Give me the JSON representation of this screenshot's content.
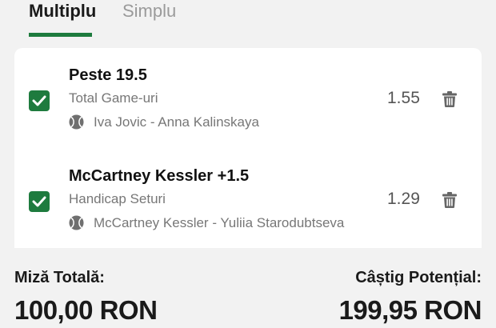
{
  "tabs": [
    {
      "label": "Multiplu",
      "active": true
    },
    {
      "label": "Simplu",
      "active": false
    }
  ],
  "bets": [
    {
      "selection": "Peste 19.5",
      "market": "Total Game-uri",
      "event": "Iva Jovic - Anna Kalinskaya",
      "odds": "1.55",
      "checked": true,
      "sport_icon": "tennis-ball-icon"
    },
    {
      "selection": "McCartney Kessler +1.5",
      "market": "Handicap Seturi",
      "event": "McCartney Kessler - Yuliia Starodubtseva",
      "odds": "1.29",
      "checked": true,
      "sport_icon": "tennis-ball-icon"
    }
  ],
  "summary": {
    "stake_label": "Miză Totală:",
    "stake_value": "100,00 RON",
    "win_label": "Câștig Potențial:",
    "win_value": "199,95 RON"
  },
  "colors": {
    "accent": "#1e7b3e",
    "background": "#f2f2f2",
    "card": "#ffffff",
    "muted_text": "#777777"
  }
}
